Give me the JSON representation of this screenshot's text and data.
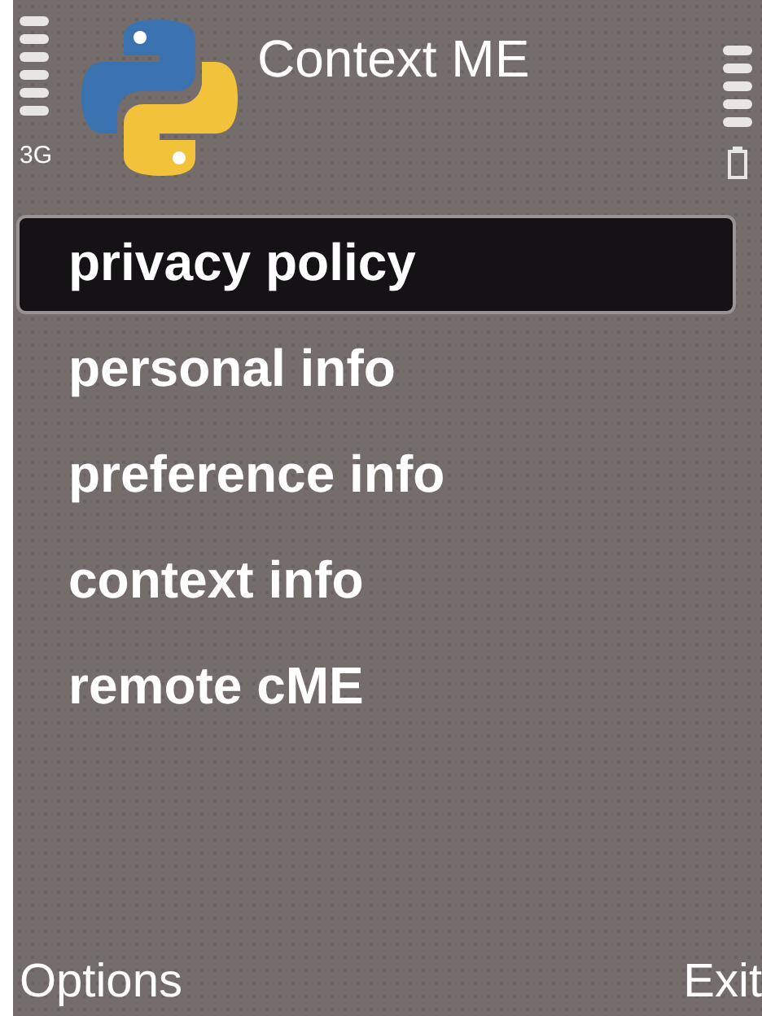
{
  "status_bar": {
    "network": "3G"
  },
  "title": "Context ME",
  "menu": [
    {
      "label": "privacy policy",
      "selected": true
    },
    {
      "label": "personal info",
      "selected": false
    },
    {
      "label": "preference info",
      "selected": false
    },
    {
      "label": "context info",
      "selected": false
    },
    {
      "label": "remote cME",
      "selected": false
    }
  ],
  "softkeys": {
    "left": "Options",
    "right": "Exit"
  }
}
